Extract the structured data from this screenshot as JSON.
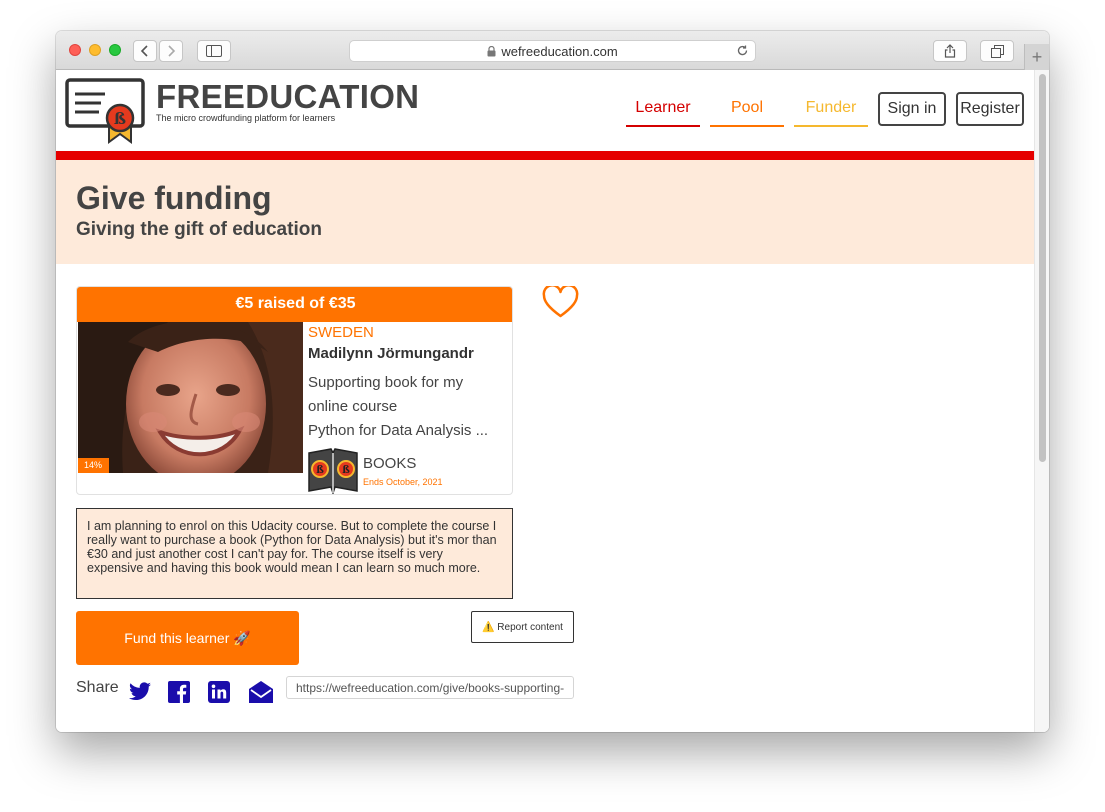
{
  "browser": {
    "url": "wefreeducation.com",
    "new_tab_label": "+"
  },
  "header": {
    "brand_title": "FREEDUCATION",
    "brand_subtitle": "The micro crowdfunding platform for learners",
    "nav": [
      {
        "label": "Learner",
        "color": "#d40000"
      },
      {
        "label": "Pool",
        "color": "#ff7300"
      },
      {
        "label": "Funder",
        "color": "#f5b82e"
      }
    ],
    "sign_in_label": "Sign in",
    "register_label": "Register"
  },
  "hero": {
    "title": "Give funding",
    "subtitle": "Giving the gift of education"
  },
  "campaign": {
    "raised_text": "€5 raised of €35",
    "progress_label": "14%",
    "progress_fraction": 0.14,
    "country": "SWEDEN",
    "learner_name": "Madilynn Jörmungandr",
    "description_lines": [
      "Supporting book for my",
      "online course",
      "Python for Data Analysis ..."
    ],
    "category": "BOOKS",
    "ends": "Ends October, 2021",
    "favorite_icon": "heart-outline-icon"
  },
  "story": "I am planning to enrol on this Udacity course. But to complete the course I really want to purchase a book (Python for Data Analysis) but it's mor than €30 and just another cost I can't pay for. The course itself is very expensive and having this book would mean I can learn so much more.",
  "actions": {
    "fund_label": "Fund this learner 🚀",
    "report_label": "⚠️ Report content"
  },
  "share": {
    "label": "Share",
    "url": "https://wefreeducation.com/give/books-supporting-book-for-my-online-course",
    "icons": [
      "twitter-icon",
      "facebook-icon",
      "linkedin-icon",
      "email-icon"
    ]
  },
  "colors": {
    "accent": "#ff7300",
    "brand_red": "#e50000",
    "hero_bg": "#feeada",
    "share_icon": "#1a0dab"
  }
}
